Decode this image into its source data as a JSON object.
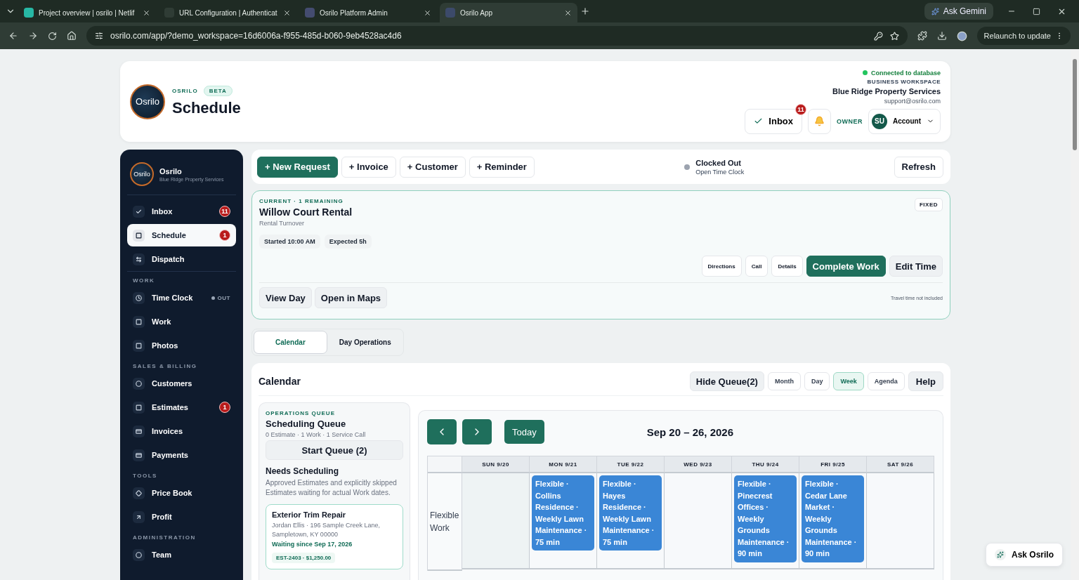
{
  "browser": {
    "tabs": [
      {
        "title": "Project overview | osrilo | Netlif",
        "selected": false
      },
      {
        "title": "URL Configuration | Authenticat",
        "selected": false
      },
      {
        "title": "Osrilo Platform Admin",
        "selected": false
      },
      {
        "title": "Osrilo App",
        "selected": true
      }
    ],
    "ask": "Ask Gemini",
    "url": "osrilo.com/app/?demo_workspace=16d6006a-f955-485d-b060-9eb4528ac4d6",
    "relaunch": "Relaunch to update"
  },
  "header": {
    "logo": "Osrilo",
    "brand": "OSRILO",
    "badge": "BETA",
    "title": "Schedule",
    "status": "Connected to database",
    "workspace_label": "BUSINESS WORKSPACE",
    "workspace": "Blue Ridge Property Services",
    "email": "support@osrilo.com",
    "inbox": "Inbox",
    "inbox_count": "11",
    "role": "OWNER",
    "initials": "SU",
    "account": "Account"
  },
  "sidebar": {
    "logo": "Osrilo",
    "name": "Osrilo",
    "sub": "Blue Ridge Property Services",
    "sections": [
      {
        "items": [
          {
            "label": "Inbox",
            "badge": "11",
            "selected": false
          },
          {
            "label": "Schedule",
            "badge": "1",
            "selected": true
          },
          {
            "label": "Dispatch",
            "selected": false
          }
        ]
      },
      {
        "heading": "WORK",
        "items": [
          {
            "label": "Time Clock",
            "status": "OUT",
            "selected": false
          },
          {
            "label": "Work",
            "selected": false
          },
          {
            "label": "Photos",
            "selected": false
          }
        ]
      },
      {
        "heading": "SALES & BILLING",
        "items": [
          {
            "label": "Customers",
            "selected": false
          },
          {
            "label": "Estimates",
            "badge": "1",
            "selected": false
          },
          {
            "label": "Invoices",
            "selected": false
          },
          {
            "label": "Payments",
            "selected": false
          }
        ]
      },
      {
        "heading": "TOOLS",
        "items": [
          {
            "label": "Price Book",
            "selected": false
          },
          {
            "label": "Profit",
            "selected": false
          }
        ]
      },
      {
        "heading": "ADMINISTRATION",
        "items": [
          {
            "label": "Team",
            "selected": false
          }
        ]
      }
    ]
  },
  "actions": {
    "buttons": [
      {
        "label": "+ New Request",
        "kind": "primary"
      },
      {
        "label": "+ Invoice",
        "kind": "plain"
      },
      {
        "label": "+ Customer",
        "kind": "plain"
      },
      {
        "label": "+ Reminder",
        "kind": "plain"
      }
    ],
    "clock_title": "Clocked Out",
    "clock_sub": "Open Time Clock",
    "refresh": "Refresh"
  },
  "current": {
    "eyebrow": "CURRENT · 1 REMAINING",
    "title": "Willow Court Rental",
    "subtitle": "Rental Turnover",
    "chips": [
      "Started 10:00 AM",
      "Expected 5h"
    ],
    "tag": "FIXED",
    "buttons": [
      {
        "label": "Directions",
        "kind": "small"
      },
      {
        "label": "Call",
        "kind": "small"
      },
      {
        "label": "Details",
        "kind": "small"
      },
      {
        "label": "Complete Work",
        "kind": "primary"
      },
      {
        "label": "Edit Time",
        "kind": "secondary"
      }
    ],
    "footer_buttons": [
      "View Day",
      "Open in Maps"
    ],
    "note": "Travel time not included"
  },
  "view_tabs": [
    {
      "label": "Calendar",
      "selected": true
    },
    {
      "label": "Day Operations",
      "selected": false
    }
  ],
  "calendar": {
    "title": "Calendar",
    "hide_queue": "Hide Queue(2)",
    "views": [
      {
        "label": "Month",
        "selected": false
      },
      {
        "label": "Day",
        "selected": false
      },
      {
        "label": "Week",
        "selected": true
      },
      {
        "label": "Agenda",
        "selected": false
      }
    ],
    "help": "Help",
    "queue": {
      "eyebrow": "OPERATIONS QUEUE",
      "title": "Scheduling Queue",
      "summary": "0 Estimate · 1 Work · 1 Service Call",
      "start": "Start Queue (2)",
      "section": "Needs Scheduling",
      "description": "Approved Estimates and explicitly skipped Estimates waiting for actual Work dates.",
      "card": {
        "title": "Exterior Trim Repair",
        "address": "Jordan Ellis · 196 Sample Creek Lane, Sampletown, KY 00000",
        "waiting": "Waiting since Sep 17, 2026",
        "tag": "EST-2403 · $1,250.00"
      }
    },
    "week": {
      "today": "Today",
      "range": "Sep 20 – 26, 2026",
      "days": [
        "SUN 9/20",
        "MON 9/21",
        "TUE 9/22",
        "WED 9/23",
        "THU 9/24",
        "FRI 9/25",
        "SAT 9/26"
      ],
      "rows": [
        {
          "label": "Flexible Work",
          "cells": [
            {
              "kind": "empty"
            },
            {
              "kind": "event",
              "text": "Flexible · Collins Residence · Weekly Lawn Maintenance · 75 min"
            },
            {
              "kind": "event",
              "text": "Flexible · Hayes Residence · Weekly Lawn Maintenance · 75 min"
            },
            {
              "kind": "empty"
            },
            {
              "kind": "event",
              "text": "Flexible · Pinecrest Offices · Weekly Grounds Maintenance · 90 min"
            },
            {
              "kind": "event",
              "text": "Flexible · Cedar Lane Market · Weekly Grounds Maintenance · 90 min"
            },
            {
              "kind": "empty"
            }
          ]
        }
      ]
    }
  },
  "assistant": "Ask Osrilo"
}
